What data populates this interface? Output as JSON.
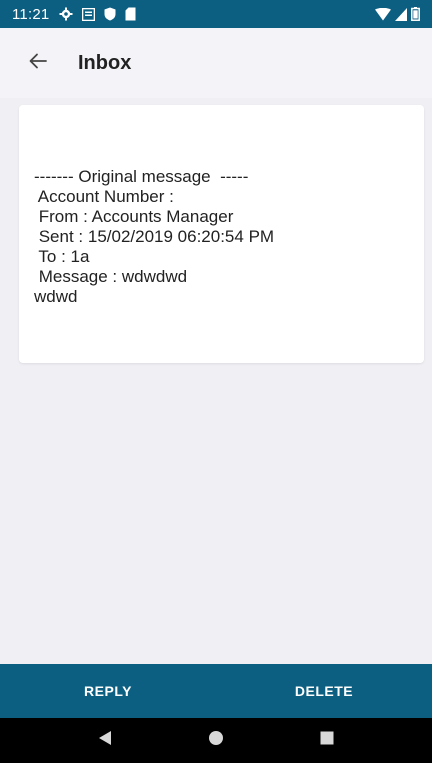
{
  "status_bar": {
    "time": "11:21",
    "icons": [
      "gear-icon",
      "message-icon",
      "shield-icon",
      "sd-card-icon"
    ],
    "right_icons": [
      "wifi-icon",
      "signal-icon",
      "battery-icon"
    ]
  },
  "app_bar": {
    "title": "Inbox",
    "back_icon": "arrow-left-icon"
  },
  "message": {
    "lines": [
      "------- Original message  -----",
      " Account Number :",
      " From : Accounts Manager",
      " Sent : 15/02/2019 06:20:54 PM",
      " To : 1a",
      " Message : wdwdwd",
      "wdwd"
    ]
  },
  "actions": {
    "reply_label": "REPLY",
    "delete_label": "DELETE"
  },
  "colors": {
    "primary": "#0d5f82",
    "background": "#f0eff4",
    "card": "#ffffff"
  },
  "nav_bar": {
    "icons": [
      "back-triangle-icon",
      "home-circle-icon",
      "recents-square-icon"
    ]
  }
}
